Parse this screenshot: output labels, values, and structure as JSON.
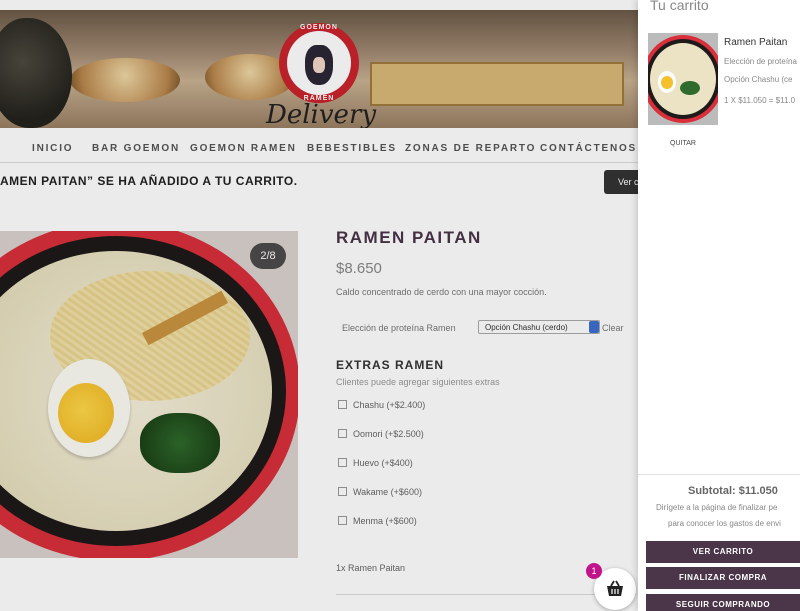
{
  "hero": {
    "logo_top_text": "GOEMON",
    "logo_bottom_text": "RAMEN",
    "tagline": "Delivery"
  },
  "nav": {
    "items": [
      "INICIO",
      "BAR GOEMON",
      "GOEMON RAMEN",
      "BEBESTIBLES",
      "ZONAS DE REPARTO",
      "CONTÁCTENOS"
    ]
  },
  "notice": {
    "text": "AMEN PAITAN” SE HA AÑADIDO A TU CARRITO.",
    "button": "Ver c"
  },
  "gallery": {
    "counter": "2/8"
  },
  "product": {
    "title": "RAMEN PAITAN",
    "price": "$8.650",
    "description": "Caldo concentrado de cerdo con una mayor cocción.",
    "option_label": "Elección de proteína Ramen",
    "option_value": "Opción Chashu (cerdo)",
    "clear": "Clear",
    "extras_title": "EXTRAS RAMEN",
    "extras_subtitle": "Clientes puede agregar siguientes extras",
    "extras": [
      "Chashu (+$2.400)",
      "Oomori (+$2.500)",
      "Huevo (+$400)",
      "Wakame (+$600)",
      "Menma (+$600)"
    ],
    "line_item": "1x Ramen Paitan"
  },
  "cart_fab": {
    "count": "1",
    "icon": "basket-icon"
  },
  "sidecart": {
    "title": "Tu carrito",
    "item_name": "Ramen Paitan",
    "item_option_label": "Elección de proteína",
    "item_option_value": "Opción Chashu (ce",
    "item_qty_price": "1 X $11.050 = $11.0",
    "remove": "QUITAR",
    "subtotal": "Subtotal: $11.050",
    "note_line1": "Dirígete a la página de finalizar pe",
    "note_line2": "para conocer los gastos de envi",
    "buttons": [
      "VER CARRITO",
      "FINALIZAR COMPRA",
      "SEGUIR COMPRANDO"
    ]
  },
  "colors": {
    "brand": "#4a3549",
    "badge": "#c0148a",
    "logo_red": "#c9232b"
  }
}
